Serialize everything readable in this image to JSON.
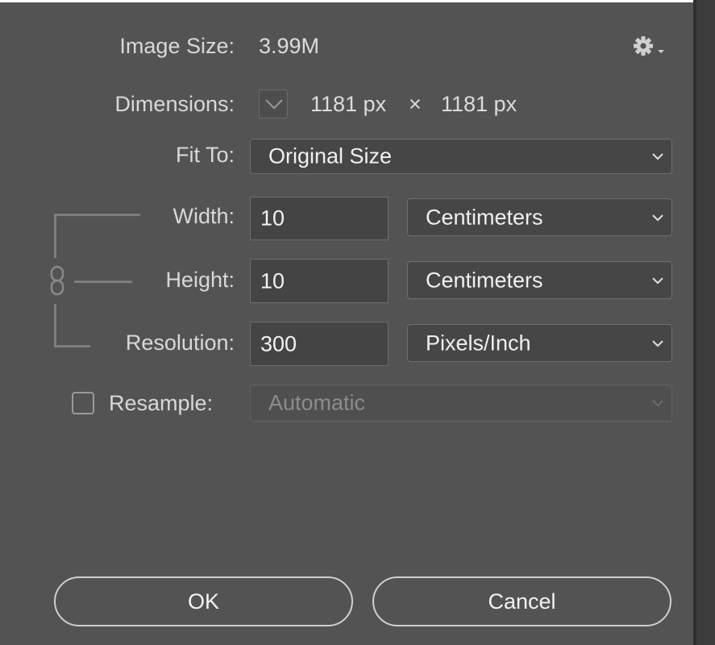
{
  "image_size": {
    "label": "Image Size:",
    "value": "3.99M"
  },
  "dimensions": {
    "label": "Dimensions:",
    "width": "1181 px",
    "times": "×",
    "height": "1181 px"
  },
  "fit_to": {
    "label": "Fit To:",
    "selected": "Original Size"
  },
  "width": {
    "label": "Width:",
    "value": "10",
    "unit": "Centimeters"
  },
  "height": {
    "label": "Height:",
    "value": "10",
    "unit": "Centimeters"
  },
  "resolution": {
    "label": "Resolution:",
    "value": "300",
    "unit": "Pixels/Inch"
  },
  "resample": {
    "label": "Resample:",
    "checked": false,
    "selected": "Automatic",
    "enabled": false
  },
  "buttons": {
    "ok": "OK",
    "cancel": "Cancel"
  },
  "colors": {
    "background": "#535353",
    "field": "#444444",
    "border": "#6e6e6e",
    "text": "#dcdcdc"
  },
  "icons": {
    "settings": "gear-icon",
    "dimensions_toggle": "chevron-down-icon",
    "constrain": "chain-link-icon"
  }
}
